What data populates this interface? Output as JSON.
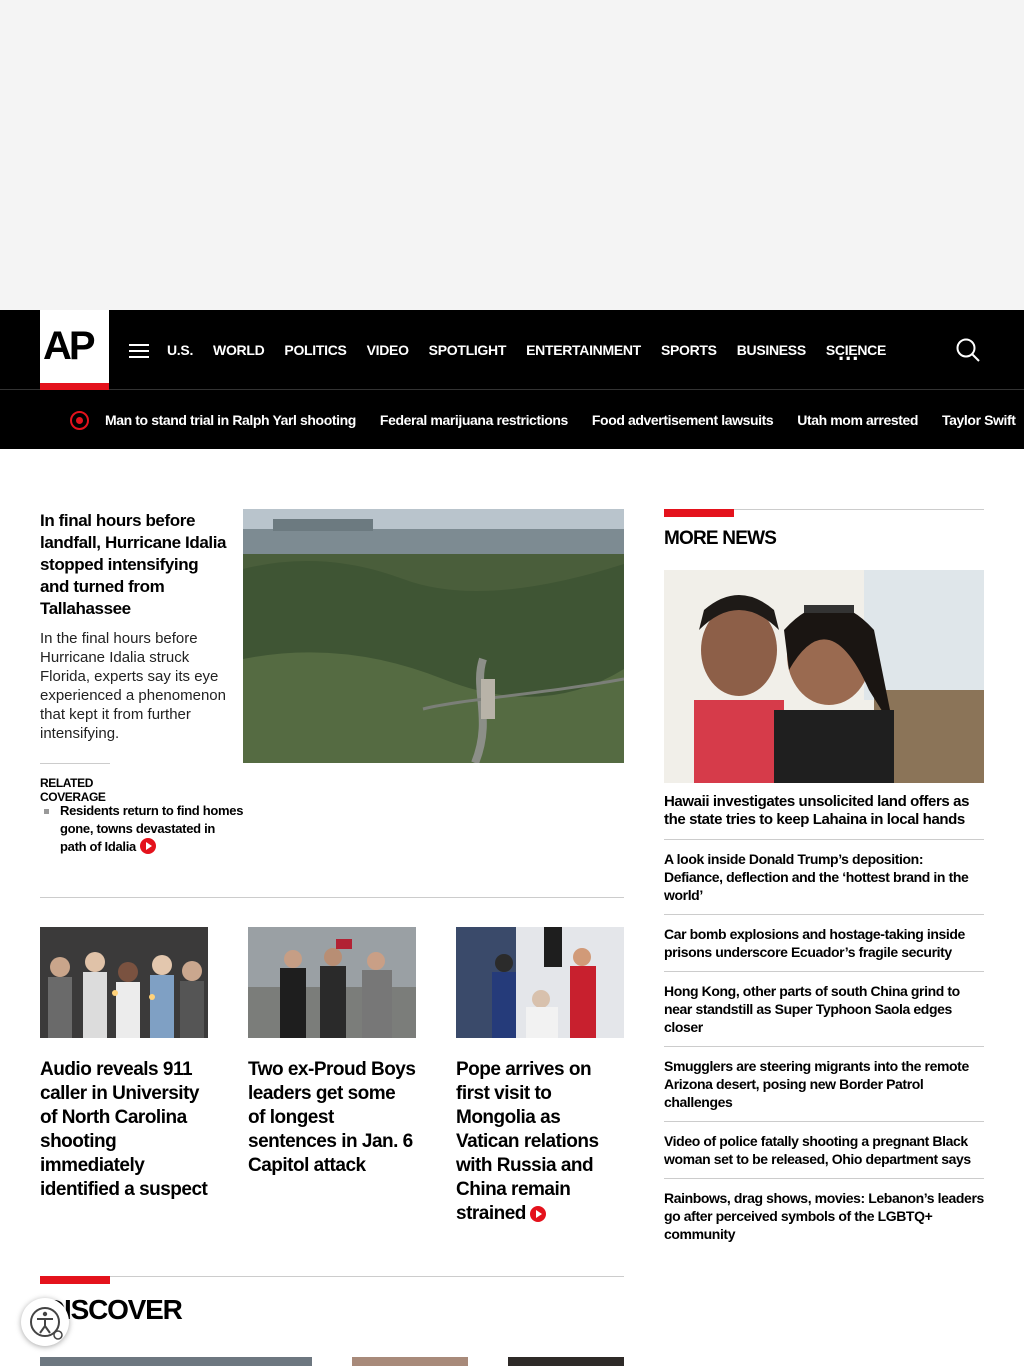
{
  "brand": {
    "logo_text": "AP"
  },
  "nav": {
    "items": [
      "U.S.",
      "WORLD",
      "POLITICS",
      "VIDEO",
      "SPOTLIGHT",
      "ENTERTAINMENT",
      "SPORTS",
      "BUSINESS",
      "SCIENCE"
    ],
    "more_label": "..."
  },
  "trending": {
    "items": [
      "Man to stand trial in Ralph Yarl shooting",
      "Federal marijuana restrictions",
      "Food advertisement lawsuits",
      "Utah mom arrested",
      "Taylor Swift"
    ]
  },
  "lead": {
    "title": "In final hours before landfall, Hurricane Idalia stopped intensifying and turned from Tallahassee",
    "description": "In the final hours before Hurricane Idalia struck Florida, experts say its eye experienced a phenomenon that kept it from further intensifying.",
    "related_heading": "RELATED COVERAGE",
    "related_item": "Residents return to find homes gone, towns devastated in path of Idalia"
  },
  "cards": [
    {
      "title": "Audio reveals 911 caller in University of North Carolina shooting immediately identified a suspect"
    },
    {
      "title": "Two ex-Proud Boys leaders get some of longest sentences in Jan. 6 Capitol attack"
    },
    {
      "title": "Pope arrives on first visit to Mongolia as Vatican relations with Russia and China remain strained"
    }
  ],
  "more_news": {
    "heading": "MORE NEWS",
    "items": [
      "Hawaii investigates unsolicited land offers as the state tries to keep Lahaina in local hands",
      "A look inside Donald Trump’s deposition: Defiance, deflection and the ‘hottest brand in the world’",
      "Car bomb explosions and hostage-taking inside prisons underscore Ecuador’s fragile security",
      "Hong Kong, other parts of south China grind to near standstill as Super Typhoon Saola edges closer",
      "Smugglers are steering migrants into the remote Arizona desert, posing new Border Patrol challenges",
      "Video of police fatally shooting a pregnant Black woman set to be released, Ohio department says",
      "Rainbows, drag shows, movies: Lebanon’s leaders go after perceived symbols of the LGBTQ+ community"
    ]
  },
  "discover": {
    "heading": "DISCOVER"
  },
  "colors": {
    "accent": "#e4121c",
    "nav_bg": "#000000"
  },
  "icons": [
    "menu-icon",
    "more-icon",
    "search-icon",
    "trending-icon",
    "play-icon",
    "accessibility-icon"
  ]
}
